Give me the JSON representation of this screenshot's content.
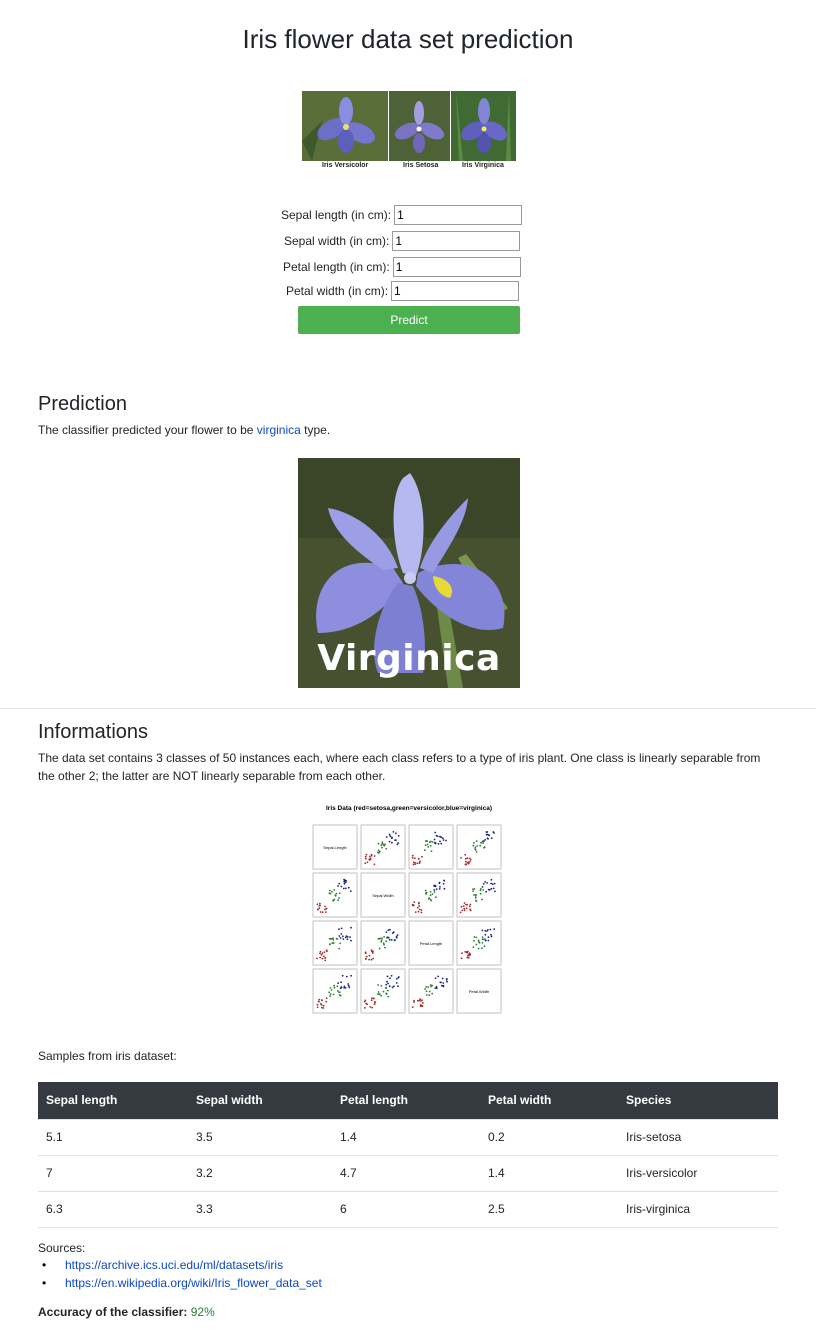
{
  "page": {
    "title": "Iris flower data set prediction"
  },
  "banner": {
    "captions": [
      "Iris Versicolor",
      "Iris Setosa",
      "Iris Virginica"
    ]
  },
  "form": {
    "fields": [
      {
        "label": "Sepal length (in cm):",
        "value": "1"
      },
      {
        "label": "Sepal width (in cm):",
        "value": "1"
      },
      {
        "label": "Petal length (in cm):",
        "value": "1"
      },
      {
        "label": "Petal width (in cm):",
        "value": "1"
      }
    ],
    "submit_label": "Predict",
    "colors": {
      "button": "#4caf50"
    }
  },
  "prediction": {
    "heading": "Prediction",
    "text_before": "The classifier predicted your flower to be",
    "predicted_class": "virginica",
    "text_after": "type.",
    "image_caption": "Virginica"
  },
  "info": {
    "heading": "Informations",
    "description": "The data set contains 3 classes of 50 instances each, where each class refers to a type of iris plant. One class is linearly separable from the other 2; the latter are NOT linearly separable from each other.",
    "scatter_title": "Iris Data (red=setosa,green=versicolor,blue=virginica)",
    "scatter_diag_labels": [
      "Sepal.Length",
      "Sepal.Width",
      "Petal.Length",
      "Petal.Width"
    ],
    "scatter_colors": {
      "setosa": "#a52a2a",
      "versicolor": "#2e7d32",
      "virginica": "#1a237e"
    }
  },
  "samples": {
    "intro": "Samples from iris dataset:",
    "columns": [
      "Sepal length",
      "Sepal width",
      "Petal length",
      "Petal width",
      "Species"
    ],
    "rows": [
      [
        "5.1",
        "3.5",
        "1.4",
        "0.2",
        "Iris-setosa"
      ],
      [
        "7",
        "3.2",
        "4.7",
        "1.4",
        "Iris-versicolor"
      ],
      [
        "6.3",
        "3.3",
        "6",
        "2.5",
        "Iris-virginica"
      ]
    ]
  },
  "sources": {
    "label": "Sources:",
    "links": [
      "https://archive.ics.uci.edu/ml/datasets/iris",
      "https://en.wikipedia.org/wiki/Iris_flower_data_set"
    ]
  },
  "accuracy": {
    "label": "Accuracy of the classifier:",
    "value": "92%"
  }
}
